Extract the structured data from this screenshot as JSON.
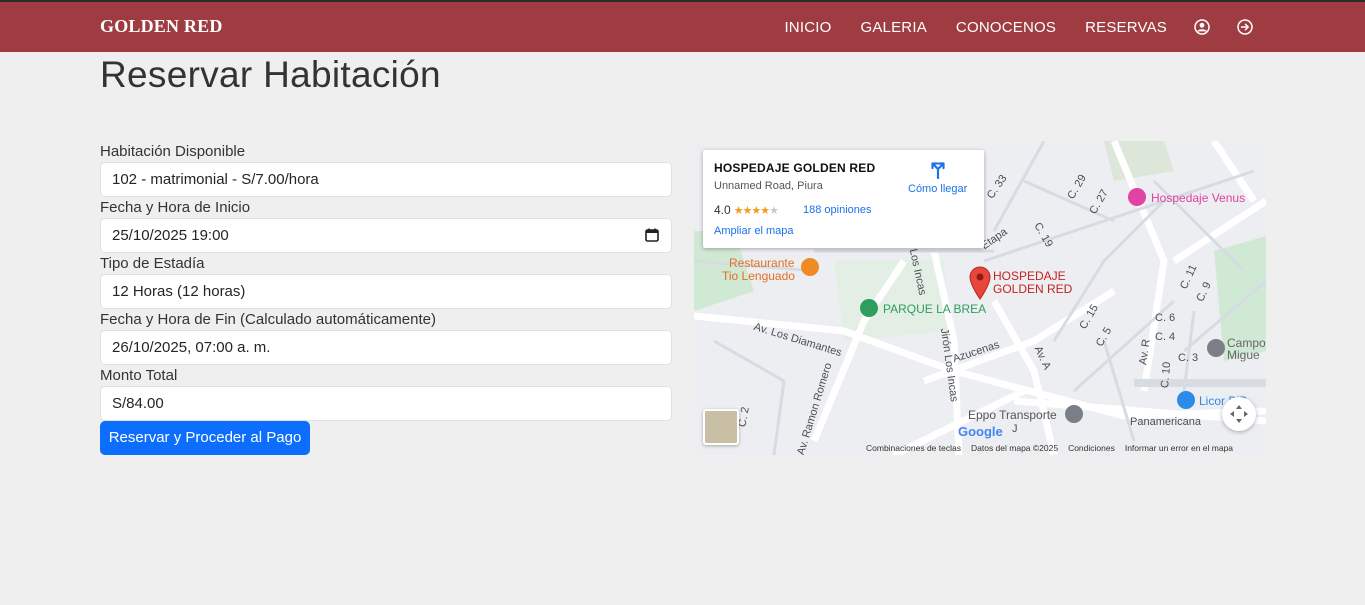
{
  "brand": "GOLDEN RED",
  "nav": {
    "items": [
      "INICIO",
      "GALERIA",
      "CONOCENOS",
      "RESERVAS"
    ],
    "icons": [
      "user-circle-icon",
      "logout-icon"
    ]
  },
  "page_title": "Reservar Habitación",
  "form": {
    "room_label": "Habitación Disponible",
    "room_value": "102 - matrimonial - S/7.00/hora",
    "start_label": "Fecha y Hora de Inicio",
    "start_value": "25/10/2025 19:00",
    "stay_label": "Tipo de Estadía",
    "stay_value": "12 Horas (12 horas)",
    "end_label": "Fecha y Hora de Fin (Calculado automáticamente)",
    "end_value": "26/10/2025, 07:00 a. m.",
    "total_label": "Monto Total",
    "total_value": "S/84.00",
    "submit_label": "Reservar y Proceder al Pago"
  },
  "map": {
    "card": {
      "title": "HOSPEDAJE GOLDEN RED",
      "address": "Unnamed Road, Piura",
      "rating": "4.0",
      "stars": "★★★★",
      "stars_off": "★",
      "reviews": "188 opiniones",
      "directions": "Cómo llegar",
      "enlarge": "Ampliar el mapa"
    },
    "marker_label_1": "HOSPEDAJE",
    "marker_label_2": "GOLDEN RED",
    "places": {
      "venus": "Hospedaje Venus",
      "restaurant_1": "Restaurante",
      "restaurant_2": "Tio Lenguado",
      "park": "PARQUE LA BREA",
      "transport": "Eppo Transporte",
      "campo_1": "Campo",
      "campo_2": "Migue",
      "lico": "Licor D'B"
    },
    "streets": {
      "diamantes": "Av. Los Diamantes",
      "romero": "Av. Ramon Romero",
      "incas": "Jirón Los Incas",
      "incas2": "Los Incas",
      "azucenas": "Azucenas",
      "ava": "Av. A",
      "avr": "Av. R",
      "panamericana": "Panamericana",
      "etapa": "Etapa",
      "c33": "C. 33",
      "c29": "C. 29",
      "c27": "C. 27",
      "c19": "C. 19",
      "c11": "C. 11",
      "c9": "C. 9",
      "c15": "C. 15",
      "c5": "C. 5",
      "c6": "C. 6",
      "c4": "C. 4",
      "c3": "C. 3",
      "c10": "C. 10",
      "c2": "C. 2",
      "j": "J"
    },
    "google": "Google",
    "attribution": [
      "Combinaciones de teclas",
      "Datos del mapa ©2025",
      "Condiciones",
      "Informar un error en el mapa"
    ]
  },
  "colors": {
    "navbar": "#9e3c42",
    "primary": "#0d6efd",
    "link": "#1a73e8",
    "marker": "#e8453c"
  }
}
